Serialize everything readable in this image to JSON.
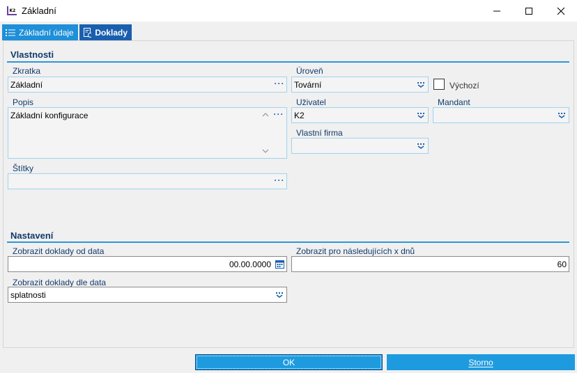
{
  "window": {
    "title": "Základní"
  },
  "tabs": [
    {
      "label": "Základní údaje"
    },
    {
      "label": "Doklady"
    }
  ],
  "vlastnosti": {
    "title": "Vlastnosti",
    "zkratka": {
      "label": "Zkratka",
      "value": "Základní"
    },
    "popis": {
      "label": "Popis",
      "value": "Základní konfigurace"
    },
    "stitky": {
      "label": "Štítky",
      "value": ""
    },
    "uroven": {
      "label": "Úroveň",
      "value": "Tovární"
    },
    "vychozi": {
      "label": "Výchozí",
      "checked": false
    },
    "uzivatel": {
      "label": "Uživatel",
      "value": "K2"
    },
    "mandant": {
      "label": "Mandant",
      "value": ""
    },
    "vlastni_firma": {
      "label": "Vlastní firma",
      "value": ""
    }
  },
  "nastaveni": {
    "title": "Nastavení",
    "od_data": {
      "label": "Zobrazit doklady od data",
      "value": "00.00.0000"
    },
    "x_dnu": {
      "label": "Zobrazit pro následujících x dnů",
      "value": "60"
    },
    "dle_data": {
      "label": "Zobrazit doklady dle data",
      "value": "splatnosti"
    }
  },
  "footer": {
    "ok_label": "OK",
    "storno_label": "Storno"
  },
  "colors": {
    "accent": "#1e9bdf",
    "tab_active": "#1e8fd8",
    "tab_inactive": "#1a5fae",
    "label": "#123a6b"
  }
}
